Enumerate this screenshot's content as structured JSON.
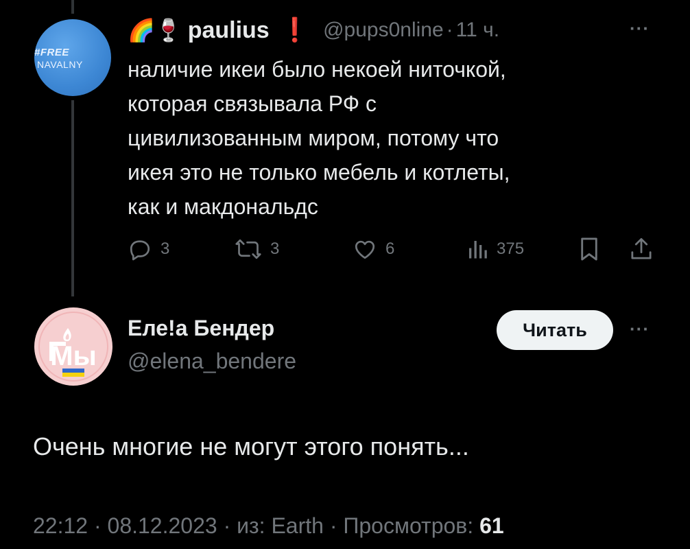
{
  "parent_tweet": {
    "avatar_text_line1": "#FREE",
    "avatar_text_line2": "NAVALNY",
    "name_emojis": "🌈🍷",
    "author_name": "paulius",
    "alert_mark": "❗",
    "handle": "@pups0nline",
    "separator": "·",
    "time": "11 ч.",
    "more_icon": "···",
    "text_lines": [
      "наличие икеи было некоей ниточкой,",
      "которая связывала РФ с",
      "цивилизованным миром, потому что",
      "икея это не только мебель и котлеты,",
      "как и макдональдс"
    ],
    "actions": {
      "replies": "3",
      "retweets": "3",
      "likes": "6",
      "views": "375"
    }
  },
  "reply_tweet": {
    "avatar_text": "Мы",
    "author_name": "Еле!а Бендер",
    "handle": "@elena_bendere",
    "follow_label": "Читать",
    "more_icon": "···",
    "text": "Очень многие не могут этого понять...",
    "meta": {
      "time": "22:12",
      "date": "08.12.2023",
      "source": "из: Earth",
      "views_label": "Просмотров:",
      "views_count": "61",
      "separator": "·"
    }
  },
  "colors": {
    "background": "#000000",
    "text_primary": "#e7e9ea",
    "text_secondary": "#71767b",
    "alert_red": "#f4212e",
    "follow_button_bg": "#eff3f4"
  }
}
